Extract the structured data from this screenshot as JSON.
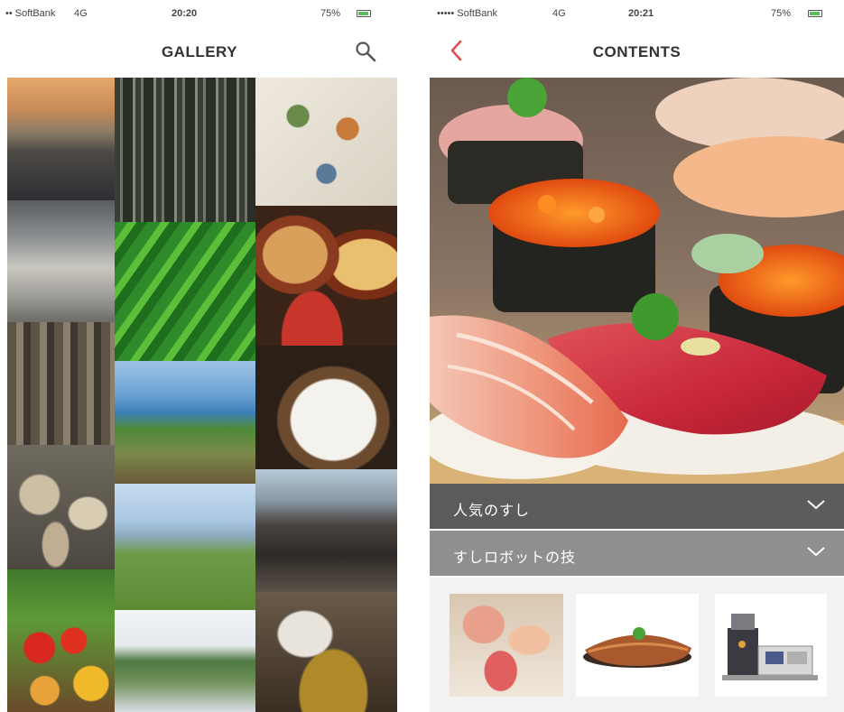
{
  "left_screen": {
    "status_bar": {
      "carrier": "•• SoftBank",
      "network": "4G",
      "time": "20:20",
      "battery": "75%"
    },
    "title": "GALLERY",
    "search_icon": "search-icon",
    "tiles": [
      "sunset-over-water-photo",
      "cedar-forest-photo",
      "plates-and-dishes-photo",
      "rocky-shoreline-photo",
      "green-leaves-photo",
      "miso-bowls-photo",
      "tree-stumps-photo",
      "coastal-cliff-photo",
      "green-onion-rice-photo",
      "oysters-photo",
      "grassland-plateau-photo",
      "grazing-cows-photo",
      "vegetables-photo",
      "mountain-valley-photo",
      "craftsman-working-photo"
    ]
  },
  "right_screen": {
    "status_bar": {
      "carrier": "••••• SoftBank",
      "network": "4G",
      "time": "20:21",
      "battery": "75%"
    },
    "title": "CONTENTS",
    "back_icon": "chevron-left-icon",
    "hero_image": "sushi-platter-photo",
    "sections": [
      {
        "label": "人気のすし"
      },
      {
        "label": "すしロボットの技"
      }
    ],
    "thumbnails": [
      "sushi-plate-thumbnail",
      "eel-sushi-thumbnail",
      "sushi-robot-thumbnail"
    ]
  },
  "colors": {
    "accent_red": "#d9534f",
    "section_dark": "#5b5b5b",
    "section_light": "#8f8f8f",
    "battery_green": "#55c05a"
  }
}
